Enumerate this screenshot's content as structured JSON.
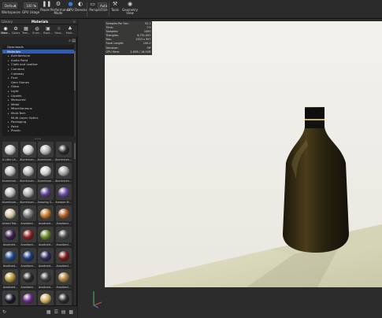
{
  "toolbar": {
    "workspace_select": "Default",
    "workspace_label": "Workspaces",
    "gpu_select": "100 %",
    "gpu_label": "GPU Usage",
    "pause_label": "Pause",
    "performance_label": "Performance Mode",
    "gpu_device_label": "GPU",
    "denoise_label": "Denoise",
    "perspective_label": "Perspective",
    "perspective_select": "Auto",
    "tools_label": "Tools",
    "geometry_label": "Geometry View"
  },
  "panel": {
    "tabs": [
      "Library",
      "Materials"
    ],
    "active_tab": "Materials",
    "categories": [
      "Mate...",
      "Colors",
      "Text...",
      "Envir...",
      "Back...",
      "Favo...",
      "Mod..."
    ],
    "tree": [
      {
        "label": "Downloads",
        "indent": 0,
        "arrow": ""
      },
      {
        "label": "Materials",
        "indent": 0,
        "arrow": "▾",
        "selected": true
      },
      {
        "label": "Architectural",
        "indent": 1,
        "arrow": "▸"
      },
      {
        "label": "Audio Paint",
        "indent": 1,
        "arrow": "▸"
      },
      {
        "label": "Cloth and Leather",
        "indent": 1,
        "arrow": "▸"
      },
      {
        "label": "Common",
        "indent": 1,
        "arrow": "▸"
      },
      {
        "label": "Cutaway",
        "indent": 1,
        "arrow": ""
      },
      {
        "label": "Fuzz",
        "indent": 1,
        "arrow": "▸"
      },
      {
        "label": "Gem Stones",
        "indent": 1,
        "arrow": ""
      },
      {
        "label": "Glass",
        "indent": 1,
        "arrow": "▸"
      },
      {
        "label": "Light",
        "indent": 1,
        "arrow": "▸"
      },
      {
        "label": "Liquids",
        "indent": 1,
        "arrow": "▸"
      },
      {
        "label": "Measured",
        "indent": 1,
        "arrow": "▸"
      },
      {
        "label": "Metal",
        "indent": 1,
        "arrow": "▸"
      },
      {
        "label": "Miscellaneous",
        "indent": 1,
        "arrow": "▸"
      },
      {
        "label": "Mold-Tech",
        "indent": 1,
        "arrow": "▸"
      },
      {
        "label": "Multi-Layer Optics",
        "indent": 1,
        "arrow": ""
      },
      {
        "label": "Packaging",
        "indent": 1,
        "arrow": "▸"
      },
      {
        "label": "Paint",
        "indent": 1,
        "arrow": "▸"
      },
      {
        "label": "Plastic",
        "indent": 1,
        "arrow": "▸"
      }
    ],
    "materials": [
      {
        "name": "A Little Lik...",
        "color": "#c8c8c8"
      },
      {
        "name": "Aluminium...",
        "color": "#d0d0d0"
      },
      {
        "name": "Aluminium...",
        "color": "#b8b8b8"
      },
      {
        "name": "Aluminium...",
        "color": "#2a2a2a"
      },
      {
        "name": "Aluminium...",
        "color": "#c4c4c4"
      },
      {
        "name": "Aluminium...",
        "color": "#bcbcbc"
      },
      {
        "name": "Aluminium...",
        "color": "#d2d2d2"
      },
      {
        "name": "Aluminium...",
        "color": "#a8a8a8"
      },
      {
        "name": "Aluminium...",
        "color": "#c0c0c0"
      },
      {
        "name": "Aluminium...",
        "color": "#b0b0b0"
      },
      {
        "name": "Amazing G...",
        "color": "#5a3f8a"
      },
      {
        "name": "Amazon M...",
        "color": "#6b4aa0"
      },
      {
        "name": "Anised Rat...",
        "color": "#d8c9a8"
      },
      {
        "name": "Anodized...",
        "color": "#7a7a7a"
      },
      {
        "name": "Anodized...",
        "color": "#c87a2a"
      },
      {
        "name": "Anodized...",
        "color": "#b0602a"
      },
      {
        "name": "Anodized...",
        "color": "#3a1f4a"
      },
      {
        "name": "Anodized...",
        "color": "#8a1f1f"
      },
      {
        "name": "Anodized...",
        "color": "#6a8a2a"
      },
      {
        "name": "Anodized...",
        "color": "#4a4a4a"
      },
      {
        "name": "Anodized...",
        "color": "#1f4a8a"
      },
      {
        "name": "Anodized...",
        "color": "#1a3a7a"
      },
      {
        "name": "Anodized...",
        "color": "#2a2a5a"
      },
      {
        "name": "Anodized...",
        "color": "#7a1a1a"
      },
      {
        "name": "Anodized...",
        "color": "#b89a3a"
      },
      {
        "name": "Anodized...",
        "color": "#2a2a2a"
      },
      {
        "name": "Anodized...",
        "color": "#3a3a3a"
      },
      {
        "name": "Anodized...",
        "color": "#a8803a"
      },
      {
        "name": "Anodized...",
        "color": "#1a1a2a"
      },
      {
        "name": "Anodized...",
        "color": "#6a2a8a"
      },
      {
        "name": "Anodized...",
        "color": "#d0b060"
      },
      {
        "name": "Anodized...",
        "color": "#2a2a2a"
      }
    ]
  },
  "stats": [
    {
      "k": "Samples Per Sec:",
      "v": "52.1"
    },
    {
      "k": "Time:",
      "v": "7:5"
    },
    {
      "k": "Samples:",
      "v": "1000"
    },
    {
      "k": "Triangles:",
      "v": "6,751,002"
    },
    {
      "k": "Res:",
      "v": "1353 x 957"
    },
    {
      "k": "Focal Length:",
      "v": "100.0"
    },
    {
      "k": "Denoiser:",
      "v": "Off"
    },
    {
      "k": "GPU Mem:",
      "v": "2.6GB / 16.0GB"
    }
  ],
  "colors": {
    "accent": "#2d5db5",
    "render_bg": "#f1efe9",
    "bottle": "#2a2412",
    "floor": "#e4e2c9"
  }
}
